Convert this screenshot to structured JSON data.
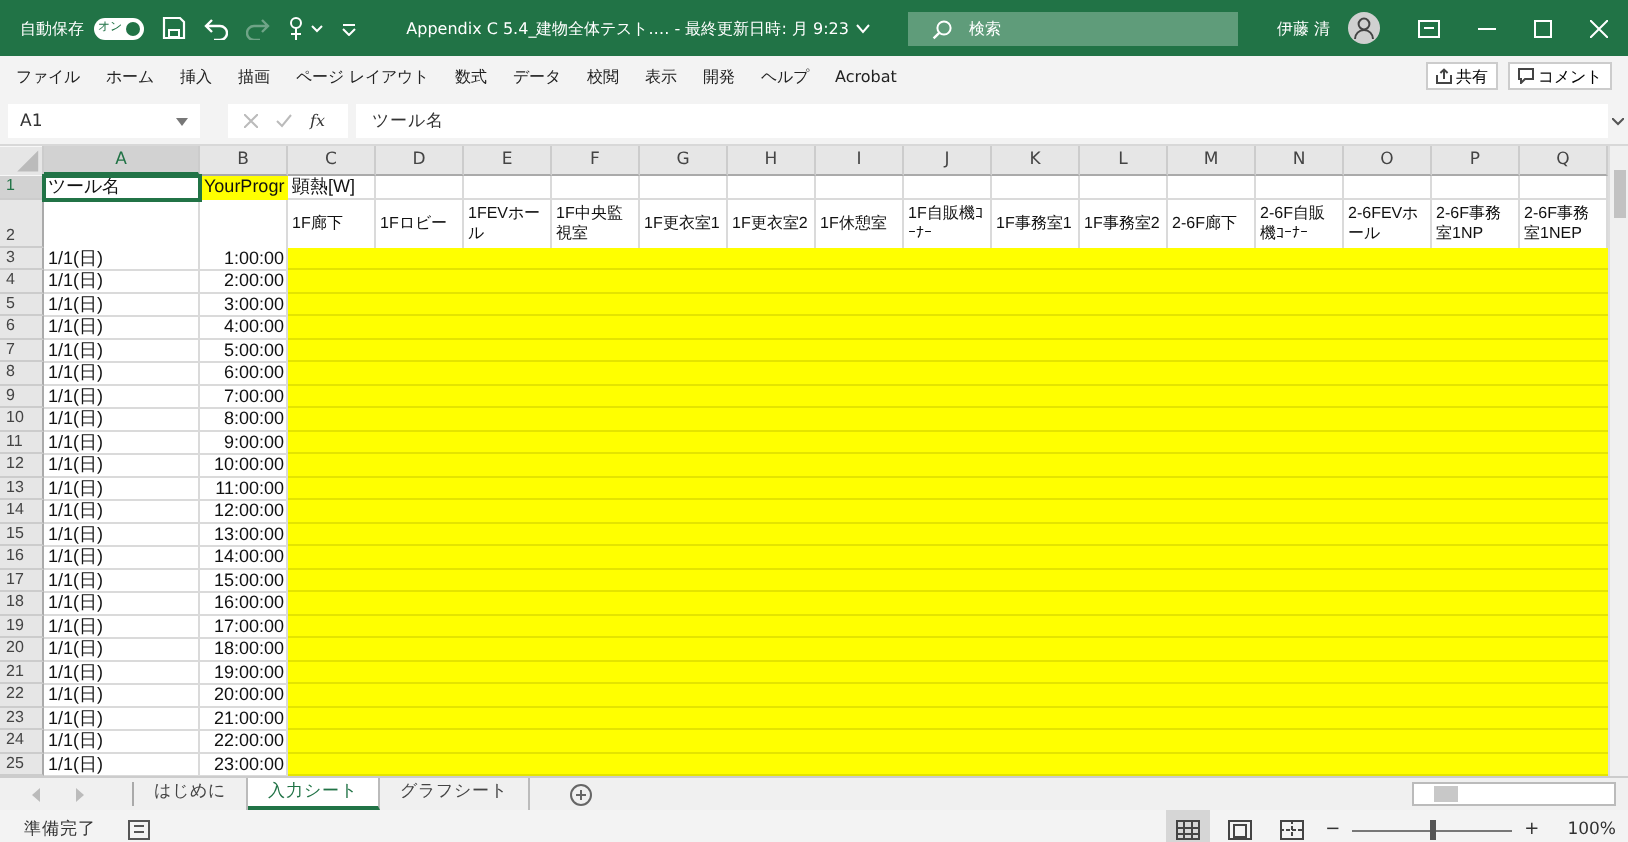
{
  "title_bar": {
    "autosave_label": "自動保存",
    "autosave_toggle": {
      "label": "オン",
      "on": true
    },
    "redo_disabled": true,
    "document_title": "Appendix C 5.4_建物全体テスト.… - 最終更新日時: 月 9:23",
    "search": {
      "placeholder": "検索"
    },
    "user_name": "伊藤 清"
  },
  "menu": [
    {
      "label": "ファイル"
    },
    {
      "label": "ホーム"
    },
    {
      "label": "挿入"
    },
    {
      "label": "描画"
    },
    {
      "label": "ページ レイアウト"
    },
    {
      "label": "数式"
    },
    {
      "label": "データ"
    },
    {
      "label": "校閲"
    },
    {
      "label": "表示"
    },
    {
      "label": "開発"
    },
    {
      "label": "ヘルプ"
    },
    {
      "label": "Acrobat"
    }
  ],
  "share_button": "共有",
  "comment_button": "コメント",
  "formula_bar": {
    "name_box": "A1",
    "function_label": "fx",
    "value": "ツール名"
  },
  "columns": [
    {
      "label": "A",
      "selected": true
    },
    {
      "label": "B",
      "selected": false
    },
    {
      "label": "C",
      "selected": false
    },
    {
      "label": "D",
      "selected": false
    },
    {
      "label": "E",
      "selected": false
    },
    {
      "label": "F",
      "selected": false
    },
    {
      "label": "G",
      "selected": false
    },
    {
      "label": "H",
      "selected": false
    },
    {
      "label": "I",
      "selected": false
    },
    {
      "label": "J",
      "selected": false
    },
    {
      "label": "K",
      "selected": false
    },
    {
      "label": "L",
      "selected": false
    },
    {
      "label": "M",
      "selected": false
    },
    {
      "label": "N",
      "selected": false
    },
    {
      "label": "O",
      "selected": false
    },
    {
      "label": "P",
      "selected": false
    },
    {
      "label": "Q",
      "selected": false
    }
  ],
  "rows": [
    {
      "number": "1",
      "selected": true,
      "kind": "title",
      "cells": [
        {
          "text": "ツール名",
          "selected": true,
          "fill": false
        },
        {
          "text": "YourProgr",
          "selected": false,
          "fill": true
        },
        {
          "text": "顕熱[W]",
          "selected": false,
          "fill": false
        }
      ]
    },
    {
      "number": "2",
      "selected": false,
      "kind": "header",
      "cells": [
        {
          "text": "1F廊下",
          "selected": false,
          "fill": false
        },
        {
          "text": "1Fロビー",
          "selected": false,
          "fill": false
        },
        {
          "text": "1FEVホール",
          "selected": false,
          "fill": false
        },
        {
          "text": "1F中央監視室",
          "selected": false,
          "fill": false
        },
        {
          "text": "1F更衣室1",
          "selected": false,
          "fill": false
        },
        {
          "text": "1F更衣室2",
          "selected": false,
          "fill": false
        },
        {
          "text": "1F休憩室",
          "selected": false,
          "fill": false
        },
        {
          "text": "1F自販機ｺｰﾅｰ",
          "selected": false,
          "fill": false
        },
        {
          "text": "1F事務室1",
          "selected": false,
          "fill": false
        },
        {
          "text": "1F事務室2",
          "selected": false,
          "fill": false
        },
        {
          "text": "2-6F廊下",
          "selected": false,
          "fill": false
        },
        {
          "text": "2-6F自販機ｺｰﾅｰ",
          "selected": false,
          "fill": false
        },
        {
          "text": "2-6FEVホール",
          "selected": false,
          "fill": false
        },
        {
          "text": "2-6F事務室1NP",
          "selected": false,
          "fill": false
        },
        {
          "text": "2-6F事務室1NEP",
          "selected": false,
          "fill": false
        }
      ]
    },
    {
      "number": "3",
      "selected": false,
      "kind": "data",
      "fill": true,
      "cells": [
        {
          "text": "1/1(日)",
          "selected": false,
          "fill": false
        },
        {
          "text": "1:00:00",
          "selected": false,
          "fill": false
        }
      ]
    },
    {
      "number": "4",
      "selected": false,
      "kind": "data",
      "fill": true,
      "cells": [
        {
          "text": "1/1(日)",
          "selected": false,
          "fill": false
        },
        {
          "text": "2:00:00",
          "selected": false,
          "fill": false
        }
      ]
    },
    {
      "number": "5",
      "selected": false,
      "kind": "data",
      "fill": true,
      "cells": [
        {
          "text": "1/1(日)",
          "selected": false,
          "fill": false
        },
        {
          "text": "3:00:00",
          "selected": false,
          "fill": false
        }
      ]
    },
    {
      "number": "6",
      "selected": false,
      "kind": "data",
      "fill": true,
      "cells": [
        {
          "text": "1/1(日)",
          "selected": false,
          "fill": false
        },
        {
          "text": "4:00:00",
          "selected": false,
          "fill": false
        }
      ]
    },
    {
      "number": "7",
      "selected": false,
      "kind": "data",
      "fill": true,
      "cells": [
        {
          "text": "1/1(日)",
          "selected": false,
          "fill": false
        },
        {
          "text": "5:00:00",
          "selected": false,
          "fill": false
        }
      ]
    },
    {
      "number": "8",
      "selected": false,
      "kind": "data",
      "fill": true,
      "cells": [
        {
          "text": "1/1(日)",
          "selected": false,
          "fill": false
        },
        {
          "text": "6:00:00",
          "selected": false,
          "fill": false
        }
      ]
    },
    {
      "number": "9",
      "selected": false,
      "kind": "data",
      "fill": true,
      "cells": [
        {
          "text": "1/1(日)",
          "selected": false,
          "fill": false
        },
        {
          "text": "7:00:00",
          "selected": false,
          "fill": false
        }
      ]
    },
    {
      "number": "10",
      "selected": false,
      "kind": "data",
      "fill": true,
      "cells": [
        {
          "text": "1/1(日)",
          "selected": false,
          "fill": false
        },
        {
          "text": "8:00:00",
          "selected": false,
          "fill": false
        }
      ]
    },
    {
      "number": "11",
      "selected": false,
      "kind": "data",
      "fill": true,
      "cells": [
        {
          "text": "1/1(日)",
          "selected": false,
          "fill": false
        },
        {
          "text": "9:00:00",
          "selected": false,
          "fill": false
        }
      ]
    },
    {
      "number": "12",
      "selected": false,
      "kind": "data",
      "fill": true,
      "cells": [
        {
          "text": "1/1(日)",
          "selected": false,
          "fill": false
        },
        {
          "text": "10:00:00",
          "selected": false,
          "fill": false
        }
      ]
    },
    {
      "number": "13",
      "selected": false,
      "kind": "data",
      "fill": true,
      "cells": [
        {
          "text": "1/1(日)",
          "selected": false,
          "fill": false
        },
        {
          "text": "11:00:00",
          "selected": false,
          "fill": false
        }
      ]
    },
    {
      "number": "14",
      "selected": false,
      "kind": "data",
      "fill": true,
      "cells": [
        {
          "text": "1/1(日)",
          "selected": false,
          "fill": false
        },
        {
          "text": "12:00:00",
          "selected": false,
          "fill": false
        }
      ]
    },
    {
      "number": "15",
      "selected": false,
      "kind": "data",
      "fill": true,
      "cells": [
        {
          "text": "1/1(日)",
          "selected": false,
          "fill": false
        },
        {
          "text": "13:00:00",
          "selected": false,
          "fill": false
        }
      ]
    },
    {
      "number": "16",
      "selected": false,
      "kind": "data",
      "fill": true,
      "cells": [
        {
          "text": "1/1(日)",
          "selected": false,
          "fill": false
        },
        {
          "text": "14:00:00",
          "selected": false,
          "fill": false
        }
      ]
    },
    {
      "number": "17",
      "selected": false,
      "kind": "data",
      "fill": true,
      "cells": [
        {
          "text": "1/1(日)",
          "selected": false,
          "fill": false
        },
        {
          "text": "15:00:00",
          "selected": false,
          "fill": false
        }
      ]
    },
    {
      "number": "18",
      "selected": false,
      "kind": "data",
      "fill": true,
      "cells": [
        {
          "text": "1/1(日)",
          "selected": false,
          "fill": false
        },
        {
          "text": "16:00:00",
          "selected": false,
          "fill": false
        }
      ]
    },
    {
      "number": "19",
      "selected": false,
      "kind": "data",
      "fill": true,
      "cells": [
        {
          "text": "1/1(日)",
          "selected": false,
          "fill": false
        },
        {
          "text": "17:00:00",
          "selected": false,
          "fill": false
        }
      ]
    },
    {
      "number": "20",
      "selected": false,
      "kind": "data",
      "fill": true,
      "cells": [
        {
          "text": "1/1(日)",
          "selected": false,
          "fill": false
        },
        {
          "text": "18:00:00",
          "selected": false,
          "fill": false
        }
      ]
    },
    {
      "number": "21",
      "selected": false,
      "kind": "data",
      "fill": true,
      "cells": [
        {
          "text": "1/1(日)",
          "selected": false,
          "fill": false
        },
        {
          "text": "19:00:00",
          "selected": false,
          "fill": false
        }
      ]
    },
    {
      "number": "22",
      "selected": false,
      "kind": "data",
      "fill": true,
      "cells": [
        {
          "text": "1/1(日)",
          "selected": false,
          "fill": false
        },
        {
          "text": "20:00:00",
          "selected": false,
          "fill": false
        }
      ]
    },
    {
      "number": "23",
      "selected": false,
      "kind": "data",
      "fill": true,
      "cells": [
        {
          "text": "1/1(日)",
          "selected": false,
          "fill": false
        },
        {
          "text": "21:00:00",
          "selected": false,
          "fill": false
        }
      ]
    },
    {
      "number": "24",
      "selected": false,
      "kind": "data",
      "fill": true,
      "cells": [
        {
          "text": "1/1(日)",
          "selected": false,
          "fill": false
        },
        {
          "text": "22:00:00",
          "selected": false,
          "fill": false
        }
      ]
    },
    {
      "number": "25",
      "selected": false,
      "kind": "data",
      "fill": true,
      "cells": [
        {
          "text": "1/1(日)",
          "selected": false,
          "fill": false
        },
        {
          "text": "23:00:00",
          "selected": false,
          "fill": false
        }
      ]
    }
  ],
  "sheet_tabs": [
    {
      "label": "はじめに",
      "selected": false
    },
    {
      "label": "入力シート",
      "selected": true
    },
    {
      "label": "グラフシート",
      "selected": false
    }
  ],
  "status_bar": {
    "status": "準備完了",
    "views": [
      {
        "kind": "normal",
        "selected": true
      },
      {
        "kind": "page-layout",
        "selected": false
      },
      {
        "kind": "page-break",
        "selected": false
      }
    ],
    "zoom": {
      "out_label": "−",
      "level": 0.5,
      "in_label": "+",
      "label": "100%"
    }
  }
}
